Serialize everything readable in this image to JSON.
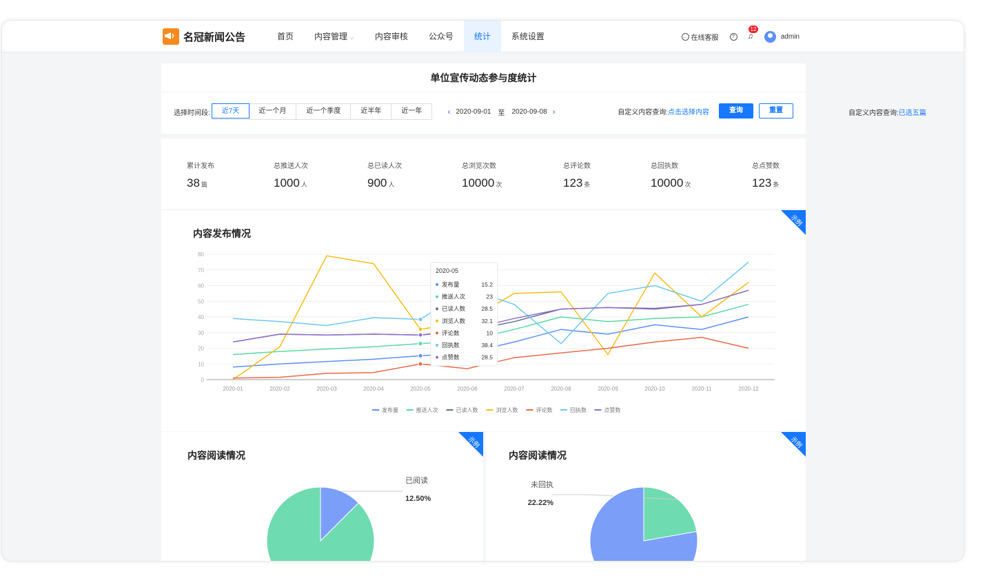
{
  "header": {
    "brand": "名冠新闻公告",
    "nav": [
      {
        "label": "首页",
        "chev": ""
      },
      {
        "label": "内容管理",
        "chev": "⌵"
      },
      {
        "label": "内容审核",
        "chev": ""
      },
      {
        "label": "公众号",
        "chev": ""
      },
      {
        "label": "统计",
        "chev": ""
      },
      {
        "label": "系统设置",
        "chev": ""
      }
    ],
    "service": "在线客服",
    "bell_count": "12",
    "user": "admin"
  },
  "filter": {
    "page_title": "单位宣传动态参与度统计",
    "label": "选择时间段:",
    "periods": [
      "近7天",
      "近一个月",
      "近一个季度",
      "近半年",
      "近一年"
    ],
    "start": "2020-09-01",
    "to": "至",
    "end": "2020-09-08",
    "custom_label": "自定义内容查询:",
    "custom_link": "点击选择内容",
    "query": "查询",
    "reset": "重置",
    "side_label": "自定义内容查询:",
    "side_value": "已选五篇"
  },
  "stats": [
    {
      "label": "累计发布",
      "value": "38",
      "unit": "篇"
    },
    {
      "label": "总推送人次",
      "value": "1000",
      "unit": "人"
    },
    {
      "label": "总已读人次",
      "value": "900",
      "unit": "人"
    },
    {
      "label": "总浏览次数",
      "value": "10000",
      "unit": "次"
    },
    {
      "label": "总评论数",
      "value": "123",
      "unit": "条"
    },
    {
      "label": "总回执数",
      "value": "10000",
      "unit": "次"
    },
    {
      "label": "总点赞数",
      "value": "123",
      "unit": "条"
    }
  ],
  "sections": {
    "publish_title": "内容发布情况",
    "read_title": "内容阅读情况",
    "receipt_title": "内容阅读情况",
    "demo_tag": "示例"
  },
  "chart_data": [
    {
      "type": "line",
      "title": "内容发布情况",
      "x": [
        "2020-01",
        "2020-02",
        "2020-03",
        "2020-04",
        "2020-05",
        "2020-06",
        "2020-07",
        "2020-08",
        "2020-09",
        "2020-10",
        "2020-11",
        "2020-12"
      ],
      "ylim": [
        0,
        80
      ],
      "yticks": [
        0,
        10,
        20,
        30,
        40,
        50,
        60,
        70,
        80
      ],
      "grid": true,
      "legend": "bottom",
      "series": [
        {
          "name": "发布量",
          "color": "#5b8ff9",
          "values": [
            8,
            10,
            11.5,
            13,
            15.2,
            17,
            24,
            32,
            29,
            35,
            32,
            40
          ]
        },
        {
          "name": "推送人次",
          "color": "#5ad8a6",
          "values": [
            16,
            18,
            19.5,
            21,
            23,
            25,
            32,
            40,
            37,
            39,
            40,
            48
          ]
        },
        {
          "name": "已读人数",
          "color": "#5d7092",
          "values": [
            24,
            29,
            28.5,
            29,
            28.5,
            31,
            37,
            45,
            46,
            45,
            48,
            57
          ]
        },
        {
          "name": "浏览人数",
          "color": "#f6bd16",
          "values": [
            0,
            21,
            79,
            74,
            32.1,
            37,
            55,
            56,
            16,
            68,
            40,
            62
          ]
        },
        {
          "name": "评论数",
          "color": "#e8684a",
          "values": [
            1,
            1.5,
            4,
            4.5,
            10,
            7,
            14,
            17,
            20,
            24,
            27,
            20
          ]
        },
        {
          "name": "回执数",
          "color": "#6dc8ec",
          "values": [
            39,
            37,
            34.5,
            39.5,
            38.4,
            58,
            48,
            23,
            55,
            60,
            50,
            75
          ]
        },
        {
          "name": "点赞数",
          "color": "#9270ca",
          "values": [
            24,
            29,
            28.5,
            29,
            28.5,
            32,
            39,
            45,
            46,
            45.5,
            48,
            57
          ]
        }
      ],
      "tooltip": {
        "title": "2020-05",
        "rows": [
          {
            "name": "发布量",
            "value": "15.2",
            "color": "#5b8ff9"
          },
          {
            "name": "推送人次",
            "value": "23",
            "color": "#5ad8a6"
          },
          {
            "name": "已读人数",
            "value": "28.5",
            "color": "#5d7092"
          },
          {
            "name": "浏览人数",
            "value": "32.1",
            "color": "#f6bd16"
          },
          {
            "name": "评论数",
            "value": "10",
            "color": "#e8684a"
          },
          {
            "name": "回执数",
            "value": "38.4",
            "color": "#6dc8ec"
          },
          {
            "name": "点赞数",
            "value": "28.5",
            "color": "#9270ca"
          }
        ]
      }
    },
    {
      "type": "pie",
      "title": "内容阅读情况",
      "slices": [
        {
          "name": "已阅读",
          "percent": 12.5,
          "label": "12.50%",
          "color": "#7b9ef9"
        },
        {
          "name": "",
          "percent": 87.5,
          "label": "",
          "color": "#6fdbb0"
        }
      ]
    },
    {
      "type": "pie",
      "title": "内容阅读情况",
      "slices": [
        {
          "name": "未回执",
          "percent": 22.22,
          "label": "22.22%",
          "color": "#6fdbb0"
        },
        {
          "name": "",
          "percent": 77.78,
          "label": "",
          "color": "#7b9ef9"
        }
      ]
    }
  ]
}
